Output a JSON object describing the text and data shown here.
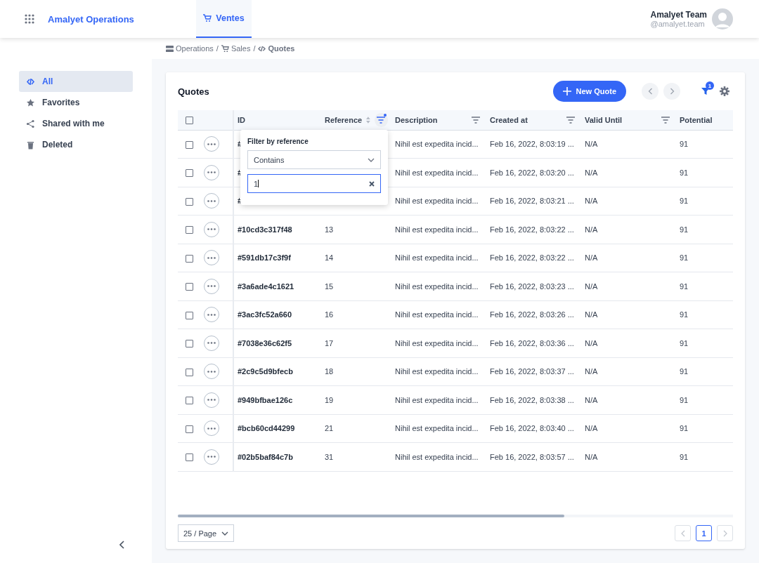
{
  "app": {
    "title": "Amalyet Operations"
  },
  "nav_tabs": [
    {
      "label": "Ventes",
      "selected": true
    }
  ],
  "user": {
    "name": "Amalyet Team",
    "handle": "@amalyet.team"
  },
  "breadcrumb": [
    {
      "label": "Operations",
      "kind": "server",
      "current": false,
      "separator": "/"
    },
    {
      "label": "Sales",
      "kind": "cart",
      "current": false,
      "separator": "/"
    },
    {
      "label": "Quotes",
      "kind": "link",
      "current": true
    }
  ],
  "sidebar": {
    "items": [
      {
        "label": "All",
        "kind": "link",
        "selected": true
      },
      {
        "label": "Favorites",
        "kind": "star",
        "selected": false
      },
      {
        "label": "Shared with me",
        "kind": "share",
        "selected": false
      },
      {
        "label": "Deleted",
        "kind": "trash",
        "selected": false
      }
    ]
  },
  "card": {
    "title": "Quotes",
    "new_button": "New Quote",
    "filter_count": "1"
  },
  "table": {
    "select_all_checked": false,
    "columns": [
      {
        "label": "ID",
        "sort": false,
        "filter": false
      },
      {
        "label": "Reference",
        "sort": true,
        "filter": true,
        "filter_active": true
      },
      {
        "label": "Description",
        "sort": false,
        "filter": true,
        "filter_active": false
      },
      {
        "label": "Created at",
        "sort": false,
        "filter": true,
        "filter_active": false
      },
      {
        "label": "Valid Until",
        "sort": false,
        "filter": true,
        "filter_active": false
      },
      {
        "label": "Potential",
        "sort": false,
        "filter": false
      }
    ],
    "rows": [
      {
        "checked": false,
        "id": "#",
        "description": "Nihil est expedita incid...",
        "created": "Feb 16, 2022, 8:03:19 ...",
        "valid": "N/A",
        "potential": "91"
      },
      {
        "checked": false,
        "id": "#",
        "description": "Nihil est expedita incid...",
        "created": "Feb 16, 2022, 8:03:20 ...",
        "valid": "N/A",
        "potential": "91"
      },
      {
        "checked": false,
        "id": "#",
        "description": "Nihil est expedita incid...",
        "created": "Feb 16, 2022, 8:03:21 ...",
        "valid": "N/A",
        "potential": "91"
      },
      {
        "checked": false,
        "id": "#10cd3c317f48",
        "reference": "13",
        "description": "Nihil est expedita incid...",
        "created": "Feb 16, 2022, 8:03:22 ...",
        "valid": "N/A",
        "potential": "91"
      },
      {
        "checked": false,
        "id": "#591db17c3f9f",
        "reference": "14",
        "description": "Nihil est expedita incid...",
        "created": "Feb 16, 2022, 8:03:22 ...",
        "valid": "N/A",
        "potential": "91"
      },
      {
        "checked": false,
        "id": "#3a6ade4c1621",
        "reference": "15",
        "description": "Nihil est expedita incid...",
        "created": "Feb 16, 2022, 8:03:23 ...",
        "valid": "N/A",
        "potential": "91"
      },
      {
        "checked": false,
        "id": "#3ac3fc52a660",
        "reference": "16",
        "description": "Nihil est expedita incid...",
        "created": "Feb 16, 2022, 8:03:26 ...",
        "valid": "N/A",
        "potential": "91"
      },
      {
        "checked": false,
        "id": "#7038e36c62f5",
        "reference": "17",
        "description": "Nihil est expedita incid...",
        "created": "Feb 16, 2022, 8:03:36 ...",
        "valid": "N/A",
        "potential": "91"
      },
      {
        "checked": false,
        "id": "#2c9c5d9bfecb",
        "reference": "18",
        "description": "Nihil est expedita incid...",
        "created": "Feb 16, 2022, 8:03:37 ...",
        "valid": "N/A",
        "potential": "91"
      },
      {
        "checked": false,
        "id": "#949bfbae126c",
        "reference": "19",
        "description": "Nihil est expedita incid...",
        "created": "Feb 16, 2022, 8:03:38 ...",
        "valid": "N/A",
        "potential": "91"
      },
      {
        "checked": false,
        "id": "#bcb60cd44299",
        "reference": "21",
        "description": "Nihil est expedita incid...",
        "created": "Feb 16, 2022, 8:03:40 ...",
        "valid": "N/A",
        "potential": "91"
      },
      {
        "checked": false,
        "id": "#02b5baf84c7b",
        "reference": "31",
        "description": "Nihil est expedita incid...",
        "created": "Feb 16, 2022, 8:03:57 ...",
        "valid": "N/A",
        "potential": "91"
      }
    ]
  },
  "filter_popup": {
    "title": "Filter by reference",
    "operator": "Contains",
    "value": "1"
  },
  "pagination": {
    "page_size": "25 / Page",
    "pages": [
      {
        "label": "1",
        "selected": true
      }
    ]
  }
}
